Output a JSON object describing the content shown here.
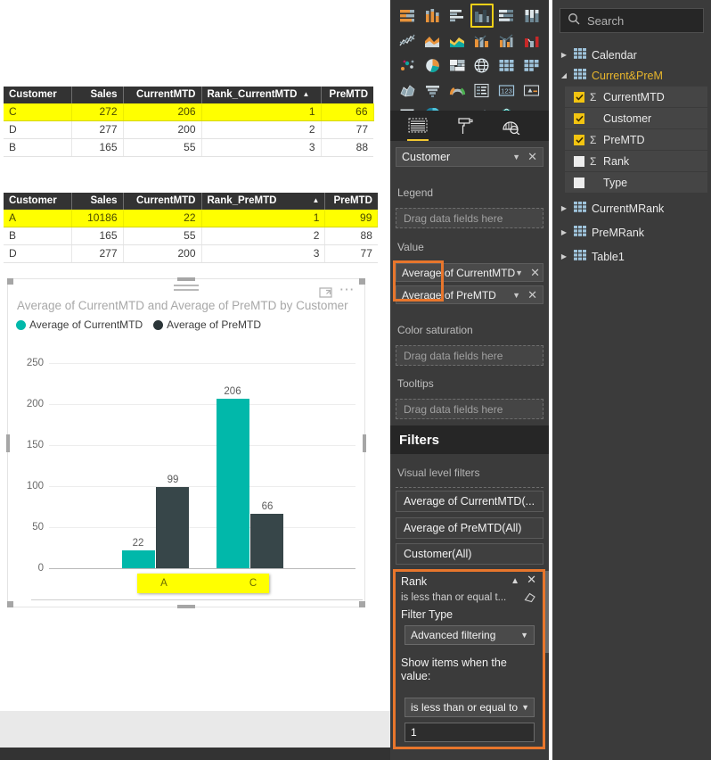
{
  "tables": [
    {
      "name": "rank-currentmtd-table",
      "columns": [
        {
          "label": "Customer",
          "align": "text"
        },
        {
          "label": "Sales",
          "align": "num"
        },
        {
          "label": "CurrentMTD",
          "align": "num"
        },
        {
          "label": "Rank_CurrentMTD",
          "align": "num",
          "sorted": true
        },
        {
          "label": "PreMTD",
          "align": "num"
        }
      ],
      "rows": [
        {
          "cells": [
            "C",
            "272",
            "206",
            "1",
            "66"
          ],
          "highlighted": true
        },
        {
          "cells": [
            "D",
            "277",
            "200",
            "2",
            "77"
          ],
          "highlighted": false
        },
        {
          "cells": [
            "B",
            "165",
            "55",
            "3",
            "88"
          ],
          "highlighted": false
        }
      ]
    },
    {
      "name": "rank-premtd-table",
      "columns": [
        {
          "label": "Customer",
          "align": "text"
        },
        {
          "label": "Sales",
          "align": "num"
        },
        {
          "label": "CurrentMTD",
          "align": "num"
        },
        {
          "label": "Rank_PreMTD",
          "align": "num",
          "sorted": true
        },
        {
          "label": "PreMTD",
          "align": "num"
        }
      ],
      "rows": [
        {
          "cells": [
            "A",
            "10186",
            "22",
            "1",
            "99"
          ],
          "highlighted": true
        },
        {
          "cells": [
            "B",
            "165",
            "55",
            "2",
            "88"
          ],
          "highlighted": false
        },
        {
          "cells": [
            "D",
            "277",
            "200",
            "3",
            "77"
          ],
          "highlighted": false
        }
      ]
    }
  ],
  "chart_visual": {
    "header": {
      "focus_icon": "focus-mode-icon",
      "more_icon": "more-options-icon",
      "drag_icon": "drag-handle-icon"
    }
  },
  "chart_data": {
    "type": "bar",
    "title": "Average of CurrentMTD and Average of PreMTD by Customer",
    "xlabel": "",
    "ylabel": "",
    "ylim": [
      0,
      250
    ],
    "yticks": [
      0,
      50,
      100,
      150,
      200,
      250
    ],
    "grid": true,
    "legend_position": "top-left",
    "categories": [
      "A",
      "C"
    ],
    "series": [
      {
        "name": "Average of CurrentMTD",
        "color": "#01b8aa",
        "values": [
          22,
          206
        ],
        "labels": [
          "22",
          "206"
        ]
      },
      {
        "name": "Average of PreMTD",
        "color": "#374649",
        "values": [
          99,
          66
        ],
        "labels": [
          "99",
          "66"
        ]
      }
    ],
    "x_axis_highlighted": true
  },
  "visualizations": {
    "gallery_title": "visualizations-gallery",
    "selected_index": 3,
    "icons": [
      "stacked-bar-chart-icon",
      "stacked-column-chart-icon",
      "clustered-bar-chart-icon",
      "clustered-column-chart-icon",
      "100-stacked-bar-chart-icon",
      "100-stacked-column-chart-icon",
      "line-chart-icon",
      "area-chart-icon",
      "stacked-area-chart-icon",
      "line-stacked-column-chart-icon",
      "line-clustered-column-chart-icon",
      "ribbon-chart-icon",
      "scatter-chart-icon",
      "pie-chart-icon",
      "treemap-icon",
      "map-icon",
      "table-icon",
      "matrix-icon",
      "filled-map-icon",
      "funnel-chart-icon",
      "gauge-icon",
      "multi-row-card-icon",
      "card-icon",
      "kpi-icon",
      "slicer-icon",
      "donut-chart-icon",
      "r-script-visual-icon",
      "shape-map-icon",
      "arcgis-map-icon",
      "more-visuals-icon"
    ],
    "tabs": [
      {
        "name": "fields-tab",
        "icon": "fields-grid-icon",
        "active": true
      },
      {
        "name": "format-tab",
        "icon": "paint-roller-icon",
        "active": false
      },
      {
        "name": "analytics-tab",
        "icon": "analytics-magnifier-icon",
        "active": false
      }
    ]
  },
  "field_wells": {
    "axis_value": "Customer",
    "axis_caret": "chevron-down-icon",
    "axis_remove": "remove-icon",
    "legend": {
      "label": "Legend",
      "placeholder": "Drag data fields here"
    },
    "value": {
      "label": "Value",
      "items": [
        {
          "text": "Average of CurrentMTD",
          "highlight_word": "Average"
        },
        {
          "text": "Average of PreMTD",
          "highlight_word": "Average"
        }
      ]
    },
    "color_saturation": {
      "label": "Color saturation",
      "placeholder": "Drag data fields here"
    },
    "tooltips": {
      "label": "Tooltips",
      "placeholder": "Drag data fields here"
    }
  },
  "filters": {
    "header": "Filters",
    "section_label": "Visual level filters",
    "chips": [
      "Average of CurrentMTD(...",
      "Average of PreMTD(All)",
      "Customer(All)"
    ],
    "expanded": {
      "title": "Rank",
      "summary": "is less than or equal t...",
      "collapse_icon": "chevron-up-icon",
      "close_icon": "close-icon",
      "clear_icon": "eraser-icon",
      "filter_type_label": "Filter Type",
      "filter_type_value": "Advanced filtering",
      "show_items_label": "Show items when the value:",
      "condition_value": "is less than or equal to",
      "condition_number": "1"
    }
  },
  "fields_pane": {
    "search_placeholder": "Search",
    "search_icon": "search-icon",
    "items": [
      {
        "kind": "table",
        "label": "Calendar",
        "expanded": false,
        "highlighted": false
      },
      {
        "kind": "table",
        "label": "Current&PreM",
        "expanded": true,
        "highlighted": true
      },
      {
        "kind": "field",
        "label": "CurrentMTD",
        "checked": true,
        "measure": true
      },
      {
        "kind": "field",
        "label": "Customer",
        "checked": true,
        "measure": false
      },
      {
        "kind": "field",
        "label": "PreMTD",
        "checked": true,
        "measure": true
      },
      {
        "kind": "field",
        "label": "Rank",
        "checked": false,
        "measure": true
      },
      {
        "kind": "field",
        "label": "Type",
        "checked": false,
        "measure": false
      },
      {
        "kind": "table",
        "label": "CurrentMRank",
        "expanded": false,
        "highlighted": false
      },
      {
        "kind": "table",
        "label": "PreMRank",
        "expanded": false,
        "highlighted": false
      },
      {
        "kind": "table",
        "label": "Table1",
        "expanded": false,
        "highlighted": false
      }
    ]
  },
  "colors": {
    "series1": "#01b8aa",
    "series2": "#374649",
    "highlight_yellow": "#ffff00",
    "annotation_orange": "#e8762c",
    "accent_gold": "#f2c411"
  }
}
